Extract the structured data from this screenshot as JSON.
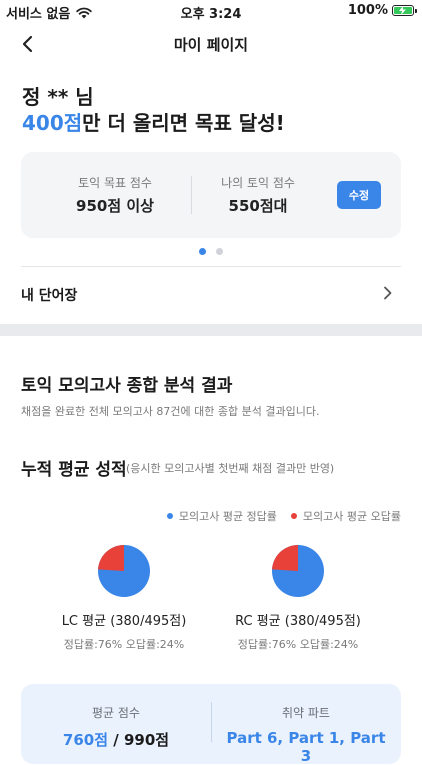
{
  "status_bar": {
    "carrier": "서비스 없음",
    "time": "오후 3:24",
    "battery": "100%"
  },
  "header": {
    "title": "마이 페이지"
  },
  "greeting": {
    "name": "정 ** 님",
    "goal_highlight": "400점",
    "goal_rest": "만 더 올리면 목표 달성!"
  },
  "scores": {
    "target_label": "토익 목표 점수",
    "target_value": "950점 이상",
    "mine_label": "나의 토익 점수",
    "mine_value": "550점대",
    "edit_label": "수정"
  },
  "carousel": {
    "pages": 2,
    "active": 0
  },
  "wordbook": {
    "label": "내 단어장"
  },
  "analysis": {
    "title": "토익 모의고사 종합 분석 결과",
    "desc": "채점을 완료한 전체 모의고사 87건에 대한 종합 분석 결과입니다."
  },
  "cumulative": {
    "title": "누적 평균 성적",
    "subtitle": "(응시한 모의고사별 첫번째 채점 결과만 반영)",
    "legend_correct": "모의고사 평균 정답률",
    "legend_wrong": "모의고사 평균 오답률"
  },
  "colors": {
    "correct": "#3a86e8",
    "wrong": "#e8413a"
  },
  "chart_data": [
    {
      "type": "pie",
      "title": "LC 평균 (380/495점)",
      "categories": [
        "모의고사 평균 정답률",
        "모의고사 평균 오답률"
      ],
      "values": [
        76,
        24
      ],
      "stats": "정답률:76%   오답률:24%"
    },
    {
      "type": "pie",
      "title": "RC 평균 (380/495점)",
      "categories": [
        "모의고사 평균 정답률",
        "모의고사 평균 오답률"
      ],
      "values": [
        76,
        24
      ],
      "stats": "정답률:76%   오답률:24%"
    }
  ],
  "summary": {
    "avg_label": "평균 점수",
    "avg_score": "760점",
    "avg_total": " / 990점",
    "weak_label": "취약 파트",
    "weak_parts": "Part 6, Part 1, Part 3"
  }
}
